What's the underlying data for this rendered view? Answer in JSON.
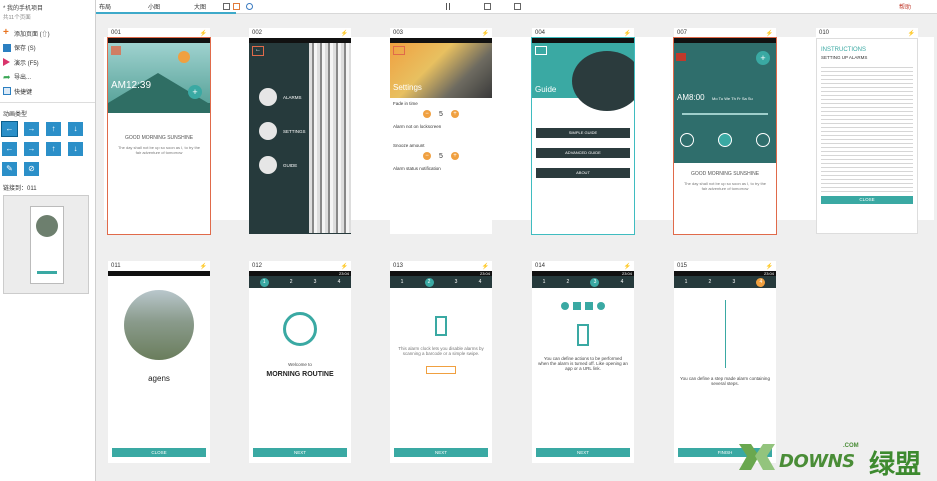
{
  "sidebar": {
    "project_title": "* 我的手机项目",
    "project_sub": "共11个页面",
    "menu": [
      {
        "label": "添加页面 (⇧)",
        "icon": "plus-icon",
        "color": "#e8731f"
      },
      {
        "label": "保存 (S)",
        "icon": "save-icon",
        "color": "#2b7fc1"
      },
      {
        "label": "演示 (F5)",
        "icon": "play-icon",
        "color": "#d9346b"
      },
      {
        "label": "导出...",
        "icon": "export-icon",
        "color": "#3aa655"
      },
      {
        "label": "快捷键",
        "icon": "keyboard-icon",
        "color": "#2b7fc1"
      }
    ],
    "anim_title": "动画类型",
    "anim_buttons": [
      "←",
      "→",
      "↑",
      "↓",
      "←",
      "→",
      "↑",
      "↓",
      "✎",
      "⊘"
    ],
    "link_label": "链接到：011"
  },
  "toolbar": {
    "tabs": [
      "布局",
      "小图",
      "大图"
    ],
    "help": "帮助"
  },
  "cards": [
    {
      "id": "001",
      "title": "AM12:39",
      "quote_title": "GOOD MORNING SUNSHINE",
      "quote": "The day shall not be up so soon as I, to try the fair adventure of tomorrow"
    },
    {
      "id": "002",
      "menu": [
        "ALARMS",
        "SETTINGS",
        "GUIDE"
      ]
    },
    {
      "id": "003",
      "title": "Settings",
      "rows": [
        "Fade in time",
        "Alarm not on lockscreen",
        "Snooze amount",
        "Alarm status notification"
      ],
      "vals": [
        "5",
        "5"
      ]
    },
    {
      "id": "004",
      "title": "Guide",
      "buttons": [
        "SIMPLE GUIDE",
        "ADVANCED GUIDE",
        "ABOUT"
      ]
    },
    {
      "id": "007",
      "title": "AM8:00",
      "days": "Mo Tu We Th Fr Sa Su",
      "quote_title": "GOOD MORNING SUNSHINE",
      "quote": "The day shall not be up so soon as I, to try the fair adventure of tomorrow"
    },
    {
      "id": "010",
      "title": "INSTRUCTIONS",
      "subtitle": "SETTING UP ALARMS",
      "button": "CLOSE"
    },
    {
      "id": "011",
      "brand": "agens",
      "button": "CLOSE"
    },
    {
      "id": "012",
      "steps": [
        "1",
        "2",
        "3",
        "4"
      ],
      "welcome": "Welcome to",
      "title": "MORNING ROUTINE",
      "button": "NEXT"
    },
    {
      "id": "013",
      "steps": [
        "1",
        "2",
        "3",
        "4"
      ],
      "text": "This alarm clock lets you disable alarms by scanning a barcode or a simple swipe.",
      "button": "NEXT"
    },
    {
      "id": "014",
      "steps": [
        "1",
        "2",
        "3",
        "4"
      ],
      "text": "You can define actions to be performed when the alarm is turned off. Like opening an app or a URL link.",
      "button": "NEXT"
    },
    {
      "id": "015",
      "steps": [
        "1",
        "2",
        "3",
        "4"
      ],
      "text": "You can define a step made alarm containing several steps.",
      "button": "FINISH"
    }
  ],
  "status_time": "23:04",
  "watermark": {
    "main": "DOWNS",
    "cn": "绿盟",
    "com": ".COM"
  },
  "colors": {
    "teal": "#3aa9a3",
    "accent_red": "#e06a4a",
    "sidebar_blue": "#2b8fc8",
    "orange": "#f0a040"
  }
}
